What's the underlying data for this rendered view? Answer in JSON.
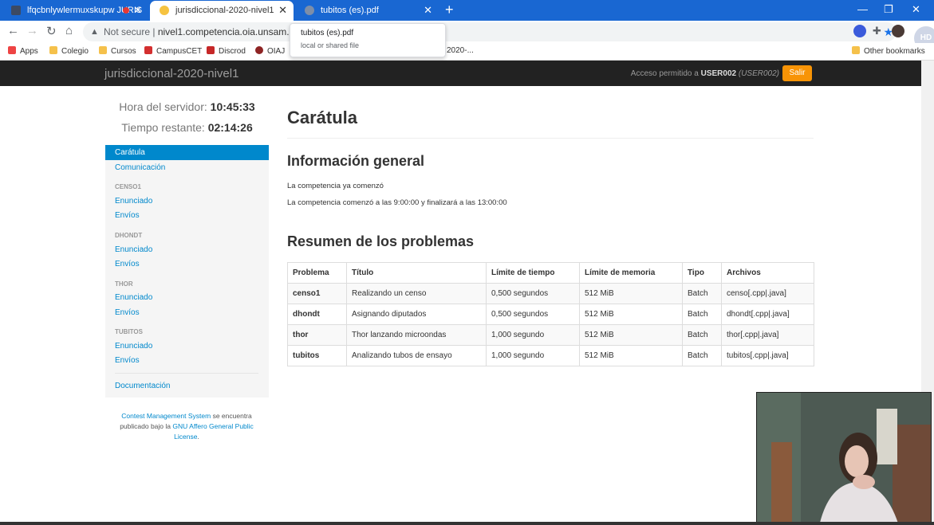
{
  "browser": {
    "tabs": [
      {
        "title": "lfqcbnlywlermuxskupw JURIS"
      },
      {
        "title": "jurisdiccional-2020-nivel1"
      },
      {
        "title": "tubitos (es).pdf"
      }
    ],
    "new_tab": "+",
    "window_controls": {
      "minimize": "—",
      "maximize": "❐",
      "close": "✕"
    },
    "address": {
      "not_secure": "Not secure",
      "url": "nivel1.competencia.oia.unsam.edu.a"
    },
    "bookmarks": [
      "Apps",
      "Colegio",
      "Cursos",
      "CampusCET",
      "Discrod",
      "OIAJ",
      "Other bookmarks"
    ],
    "bookmark_partial": "2020-...",
    "tooltip": {
      "title": "tubitos (es).pdf",
      "subtitle": "local or shared file"
    },
    "profile_badge": "HD"
  },
  "navbar": {
    "brand": "jurisdiccional-2020-nivel1",
    "access_prefix": "Acceso permitido a ",
    "user": "USER002",
    "user_paren": "(USER002)",
    "logout": "Salir"
  },
  "sidebar": {
    "server_time_label": "Hora del servidor:",
    "server_time": "10:45:33",
    "remaining_label": "Tiempo restante:",
    "remaining": "02:14:26",
    "items": [
      {
        "label": "Carátula"
      },
      {
        "label": "Comunicación"
      }
    ],
    "tasks": [
      {
        "header": "CENSO1",
        "statement": "Enunciado",
        "submissions": "Envíos"
      },
      {
        "header": "DHONDT",
        "statement": "Enunciado",
        "submissions": "Envíos"
      },
      {
        "header": "THOR",
        "statement": "Enunciado",
        "submissions": "Envíos"
      },
      {
        "header": "TUBITOS",
        "statement": "Enunciado",
        "submissions": "Envíos"
      }
    ],
    "docs": "Documentación"
  },
  "footer": {
    "cms": "Contest Management System",
    "mid": " se encuentra publicado bajo la ",
    "license": "GNU Affero General Public License",
    "end": "."
  },
  "main": {
    "title": "Carátula",
    "general_heading": "Información general",
    "started": "La competencia ya comenzó",
    "schedule": "La competencia comenzó a las 9:00:00 y finalizará a las 13:00:00",
    "summary_heading": "Resumen de los problemas",
    "table": {
      "headers": [
        "Problema",
        "Título",
        "Límite de tiempo",
        "Límite de memoria",
        "Tipo",
        "Archivos"
      ],
      "rows": [
        [
          "censo1",
          "Realizando un censo",
          "0,500 segundos",
          "512 MiB",
          "Batch",
          "censo[.cpp|.java]"
        ],
        [
          "dhondt",
          "Asignando diputados",
          "0,500 segundos",
          "512 MiB",
          "Batch",
          "dhondt[.cpp|.java]"
        ],
        [
          "thor",
          "Thor lanzando microondas",
          "1,000 segundo",
          "512 MiB",
          "Batch",
          "thor[.cpp|.java]"
        ],
        [
          "tubitos",
          "Analizando tubos de ensayo",
          "1,000 segundo",
          "512 MiB",
          "Batch",
          "tubitos[.cpp|.java]"
        ]
      ]
    }
  }
}
